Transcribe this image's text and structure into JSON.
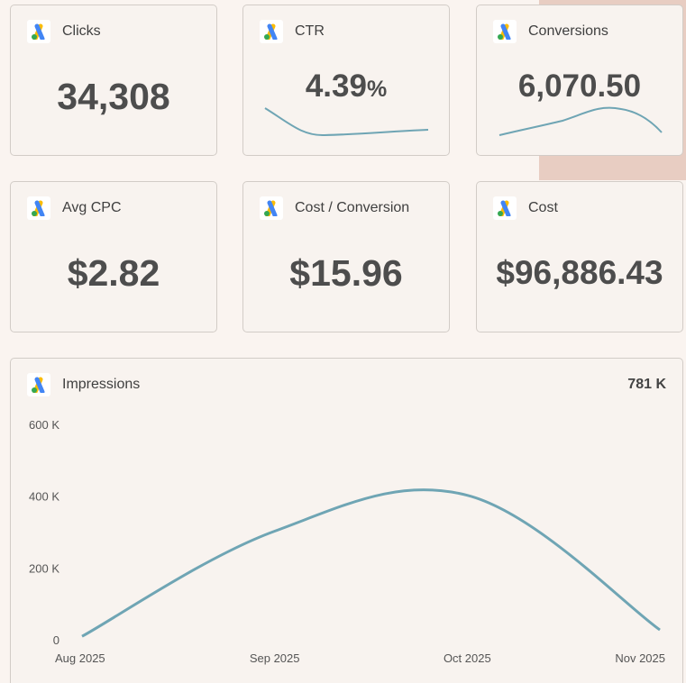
{
  "cards": [
    {
      "title": "Clicks",
      "value": "34,308"
    },
    {
      "title": "CTR",
      "value": "4.39",
      "unit": "%"
    },
    {
      "title": "Conversions",
      "value": "6,070.50"
    },
    {
      "title": "Avg CPC",
      "value": "$2.82"
    },
    {
      "title": "Cost / Conversion",
      "value": "$15.96"
    },
    {
      "title": "Cost",
      "value": "$96,886.43"
    }
  ],
  "impressions": {
    "title": "Impressions",
    "total": "781 K"
  },
  "icons": {
    "card_logo": "google-ads-icon"
  },
  "colors": {
    "line": "#6fa5b4",
    "logo_blue": "#4285f4",
    "logo_yellow": "#fbbc04",
    "logo_green": "#34a853"
  },
  "chart_data": {
    "type": "line",
    "x": [
      "Aug 2025",
      "Sep 2025",
      "Oct 2025",
      "Nov 2025"
    ],
    "y_ticks": [
      "0",
      "200 K",
      "400 K",
      "600 K"
    ],
    "ylim": [
      0,
      600000
    ],
    "series": [
      {
        "points": [
          [
            "Aug 2025",
            12000
          ],
          [
            "Sep 2025",
            305000
          ],
          [
            "Oct 2025",
            405000
          ],
          [
            "Nov 2025",
            30000
          ]
        ]
      }
    ]
  }
}
